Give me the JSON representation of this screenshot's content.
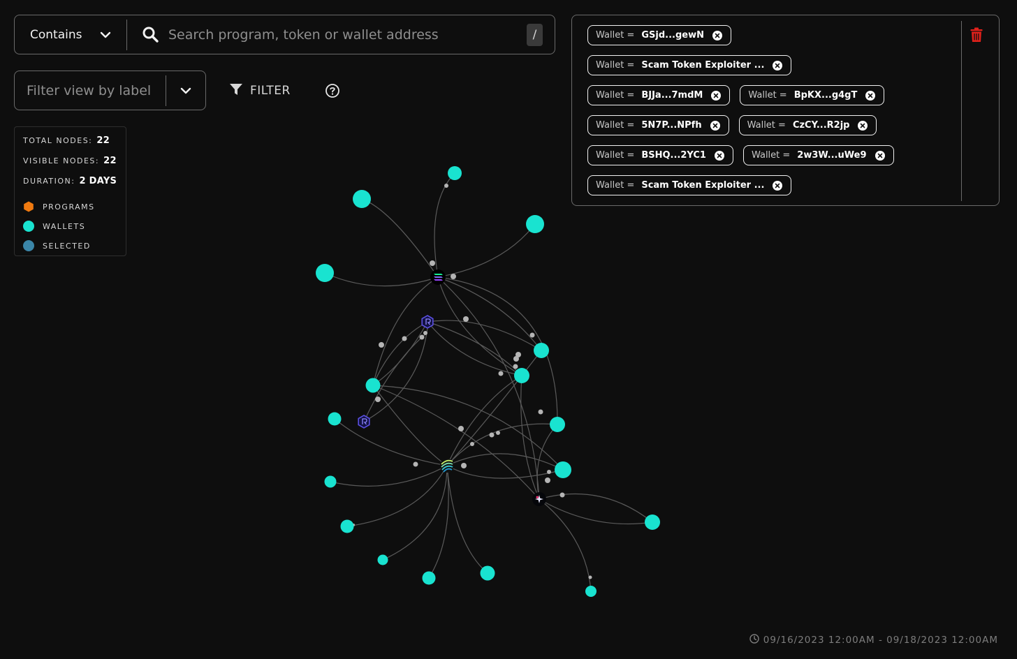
{
  "search": {
    "mode": "Contains",
    "placeholder": "Search program, token or wallet address",
    "shortcut": "/"
  },
  "label_filter": {
    "placeholder": "Filter view by label"
  },
  "filter_button": {
    "label": "FILTER"
  },
  "stats": {
    "total_nodes_label": "TOTAL NODES:",
    "total_nodes": "22",
    "visible_nodes_label": "VISIBLE NODES:",
    "visible_nodes": "22",
    "duration_label": "DURATION:",
    "duration": "2 DAYS",
    "legend": [
      {
        "label": "PROGRAMS",
        "icon": "hexagon-icon",
        "color": "#f07a10"
      },
      {
        "label": "WALLETS",
        "icon": "circle-icon",
        "color": "#19e3d0"
      },
      {
        "label": "SELECTED",
        "icon": "circle-icon",
        "color": "#3b86a8"
      }
    ]
  },
  "chips": [
    [
      {
        "key": "Wallet =",
        "value": "GSjd...gewN"
      }
    ],
    [
      {
        "key": "Wallet =",
        "value": "Scam Token Exploiter ..."
      }
    ],
    [
      {
        "key": "Wallet =",
        "value": "BJJa...7mdM"
      },
      {
        "key": "Wallet =",
        "value": "BpKX...g4gT"
      }
    ],
    [
      {
        "key": "Wallet =",
        "value": "5N7P...NPfh"
      },
      {
        "key": "Wallet =",
        "value": "CzCY...R2jp"
      }
    ],
    [
      {
        "key": "Wallet =",
        "value": "BSHQ...2YC1"
      },
      {
        "key": "Wallet =",
        "value": "2w3W...uWe9"
      }
    ],
    [
      {
        "key": "Wallet =",
        "value": "Scam Token Exploiter ..."
      }
    ]
  ],
  "date_range": "09/16/2023 12:00AM - 09/18/2023 12:00AM",
  "colors": {
    "wallet": "#19e3d0",
    "program": "#f07a10",
    "selected": "#3b86a8",
    "edge": "#5a5a5a",
    "trash": "#e0211b"
  },
  "graph": {
    "hubs": [
      {
        "id": "solana",
        "icon": "solana-logo-icon"
      },
      {
        "id": "raydium-1",
        "icon": "raydium-logo-icon"
      },
      {
        "id": "raydium-2",
        "icon": "raydium-logo-icon"
      },
      {
        "id": "striped",
        "icon": "striped-logo-icon"
      },
      {
        "id": "jupiter",
        "icon": "jupiter-logo-icon"
      }
    ],
    "wallet_count": 17
  }
}
